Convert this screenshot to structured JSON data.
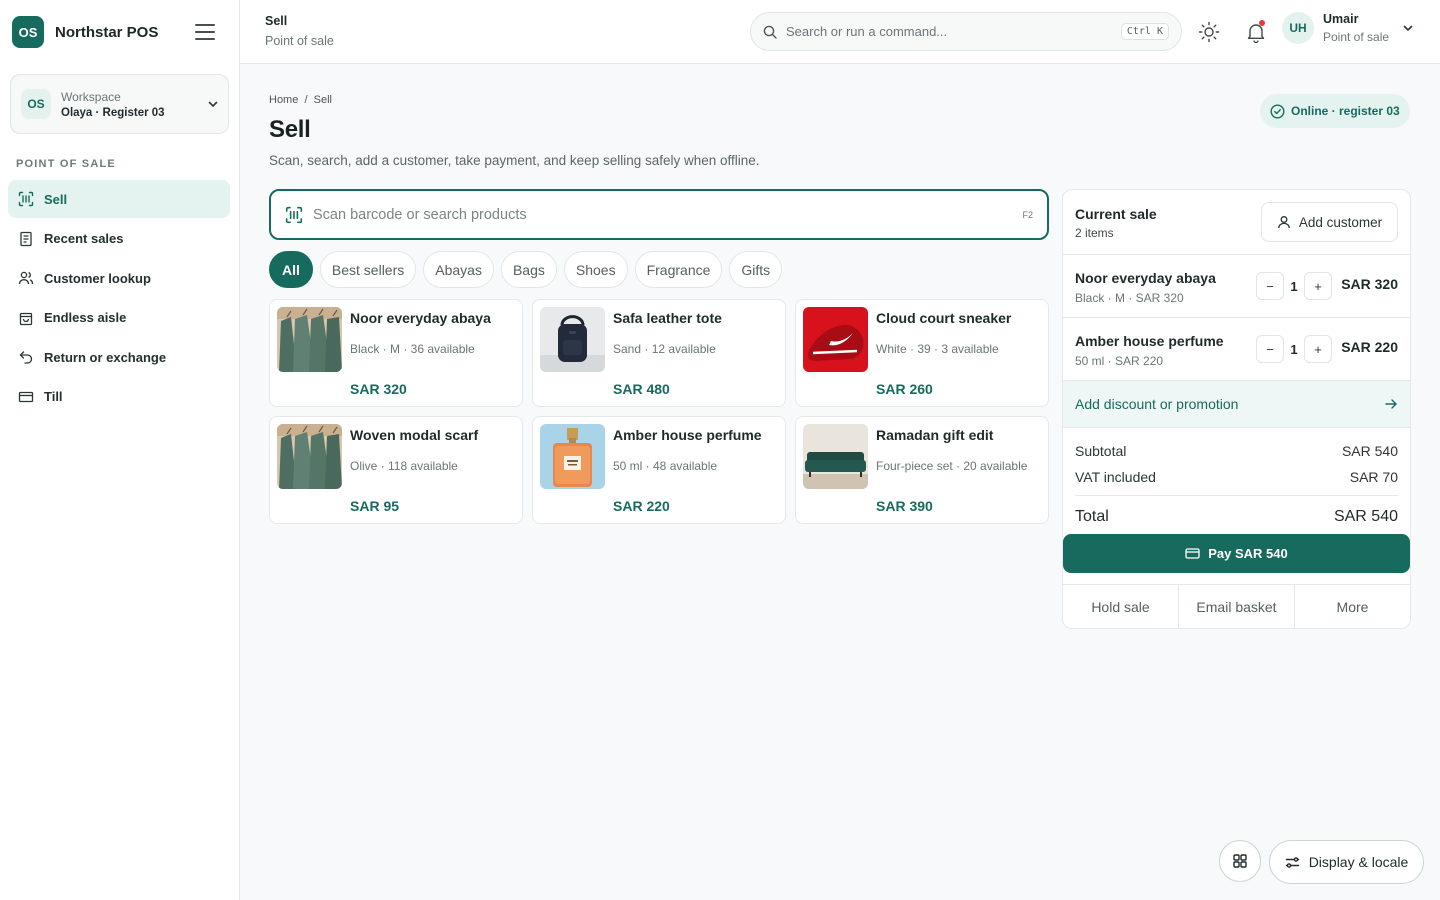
{
  "app": {
    "logo": "OS",
    "name": "Northstar POS"
  },
  "workspace": {
    "badge": "OS",
    "label": "Workspace",
    "value": "Olaya · Register 03"
  },
  "nav": {
    "section": "POINT OF SALE",
    "items": [
      {
        "label": "Sell",
        "icon": "barcode-scan-icon",
        "active": true
      },
      {
        "label": "Recent sales",
        "icon": "receipt-icon"
      },
      {
        "label": "Customer lookup",
        "icon": "users-icon"
      },
      {
        "label": "Endless aisle",
        "icon": "shopping-bag-icon"
      },
      {
        "label": "Return or exchange",
        "icon": "return-arrow-icon"
      },
      {
        "label": "Till",
        "icon": "cash-drawer-icon"
      }
    ]
  },
  "topbar": {
    "title": "Sell",
    "subtitle": "Point of sale",
    "search_placeholder": "Search or run a command...",
    "shortcut": "Ctrl K",
    "user": {
      "initials": "UH",
      "name": "Umair",
      "role": "Point of sale"
    }
  },
  "page": {
    "breadcrumb": "Home  /  Sell",
    "title": "Sell",
    "description": "Scan, search, add a customer, take payment, and keep selling safely when offline.",
    "status": "Online · register 03"
  },
  "scan": {
    "placeholder": "Scan barcode or search products",
    "shortcut": "F2"
  },
  "categories": [
    "All",
    "Best sellers",
    "Abayas",
    "Bags",
    "Shoes",
    "Fragrance",
    "Gifts"
  ],
  "products": [
    {
      "name": "Noor everyday abaya",
      "meta": "Black · M · 36 available",
      "price": "SAR 320",
      "thumb": "garments"
    },
    {
      "name": "Safa leather tote",
      "meta": "Sand · 12 available",
      "price": "SAR 480",
      "thumb": "backpack"
    },
    {
      "name": "Cloud court sneaker",
      "meta": "White · 39 · 3 available",
      "price": "SAR 260",
      "thumb": "sneaker"
    },
    {
      "name": "Woven modal scarf",
      "meta": "Olive · 118 available",
      "price": "SAR 95",
      "thumb": "garments"
    },
    {
      "name": "Amber house perfume",
      "meta": "50 ml · 48 available",
      "price": "SAR 220",
      "thumb": "perfume"
    },
    {
      "name": "Ramadan gift edit",
      "meta": "Four-piece set · 20 available",
      "price": "SAR 390",
      "thumb": "sofa"
    }
  ],
  "cart": {
    "title": "Current sale",
    "count": "2 items",
    "add_customer": "Add customer",
    "lines": [
      {
        "name": "Noor everyday abaya",
        "meta": "Black · M · SAR 320",
        "qty": "1",
        "price": "SAR 320"
      },
      {
        "name": "Amber house perfume",
        "meta": "50 ml · SAR 220",
        "qty": "1",
        "price": "SAR 220"
      }
    ],
    "promo": "Add discount or promotion",
    "subtotal_label": "Subtotal",
    "subtotal": "SAR 540",
    "vat_label": "VAT included",
    "vat": "SAR 70",
    "total_label": "Total",
    "total": "SAR 540",
    "pay": "Pay SAR 540",
    "actions": [
      "Hold sale",
      "Email basket",
      "More"
    ]
  },
  "footer": {
    "display_locale": "Display & locale"
  },
  "colors": {
    "brand": "#176b5e",
    "brand_soft": "#e4f3ef",
    "notification": "#e23b3b"
  }
}
